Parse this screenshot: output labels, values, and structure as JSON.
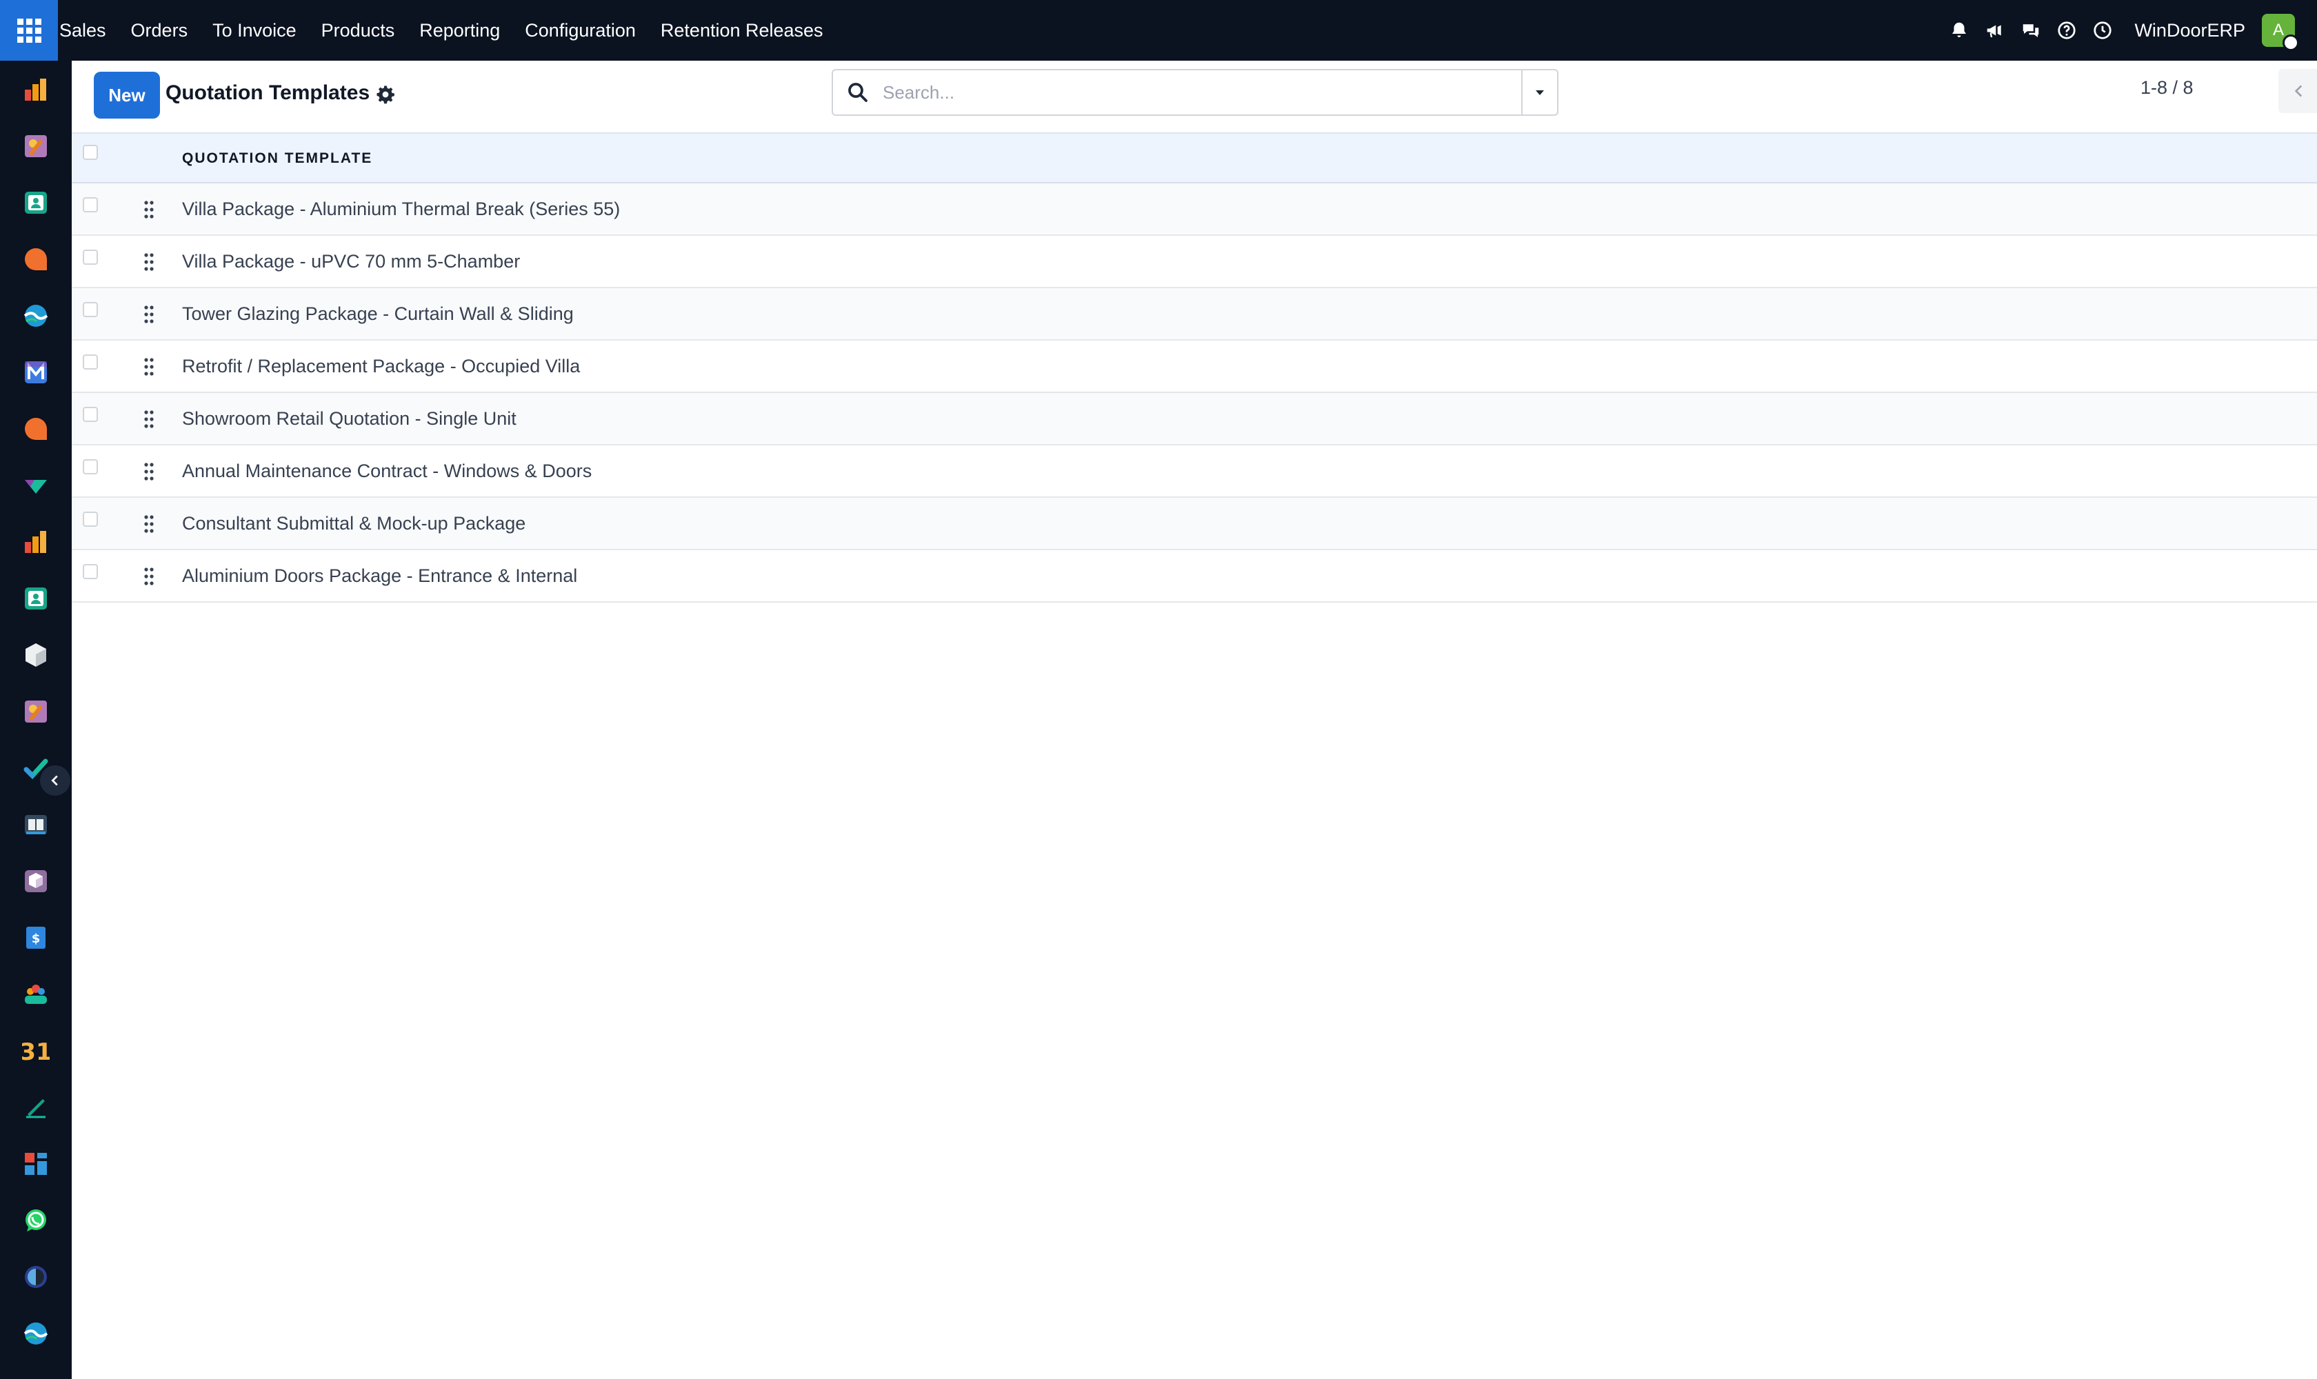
{
  "topbar": {
    "menu": [
      "Sales",
      "Orders",
      "To Invoice",
      "Products",
      "Reporting",
      "Configuration",
      "Retention Releases"
    ],
    "company": "WinDoorERP",
    "avatar_initial": "A",
    "icons": [
      "bell-icon",
      "megaphone-icon",
      "chat-icon",
      "help-icon",
      "clock-icon"
    ]
  },
  "sidebar": {
    "apps": [
      "sales-app-icon",
      "project-app-icon",
      "contacts-app-icon",
      "discuss-app-icon",
      "website-app-icon",
      "email-marketing-app-icon",
      "live-chat-app-icon",
      "purchase-app-icon",
      "sales-app-icon",
      "contacts-app-icon",
      "inventory-app-icon",
      "project-app-icon",
      "todo-app-icon",
      "knowledge-app-icon",
      "product-app-icon",
      "expenses-app-icon",
      "employees-app-icon",
      "calendar-app-icon",
      "sign-app-icon",
      "dashboards-app-icon",
      "whatsapp-app-icon",
      "time-off-app-icon",
      "website-app-icon"
    ],
    "calendar_day": "31"
  },
  "control": {
    "new_label": "New",
    "title": "Quotation Templates",
    "search_placeholder": "Search...",
    "pager": "1-8 / 8"
  },
  "list": {
    "column": "QUOTATION TEMPLATE",
    "rows": [
      "Villa Package - Aluminium Thermal Break (Series 55)",
      "Villa Package - uPVC 70 mm 5-Chamber",
      "Tower Glazing Package - Curtain Wall & Sliding",
      "Retrofit / Replacement Package - Occupied Villa",
      "Showroom Retail Quotation - Single Unit",
      "Annual Maintenance Contract - Windows & Doors",
      "Consultant Submittal & Mock-up Package",
      "Aluminium Doors Package - Entrance & Internal"
    ]
  },
  "colors": {
    "navbar": "#0b1220",
    "primary": "#1f6fd8",
    "header_row": "#eef4fd"
  }
}
